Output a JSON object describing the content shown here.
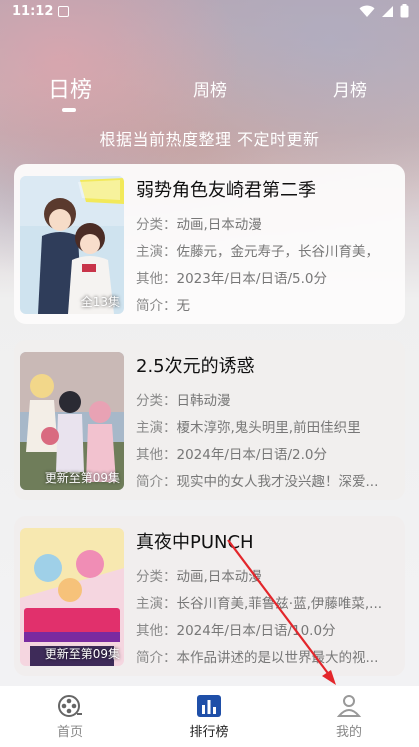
{
  "status_bar": {
    "time": "11:12"
  },
  "tabs": [
    {
      "label": "日榜",
      "active": true
    },
    {
      "label": "周榜",
      "active": false
    },
    {
      "label": "月榜",
      "active": false
    }
  ],
  "subtitle": "根据当前热度整理 不定时更新",
  "cards": [
    {
      "title": "弱势角色友崎君第二季",
      "episodes": "全13集",
      "category_key": "分类：",
      "category": "动画,日本动漫",
      "cast_key": "主演：",
      "cast": "佐藤元，金元寿子，长谷川育美，",
      "other_key": "其他：",
      "other": "2023年/日本/日语/5.0分",
      "intro_key": "简介：",
      "intro": "无"
    },
    {
      "title": "2.5次元的诱惑",
      "episodes": "更新至第09集",
      "category_key": "分类：",
      "category": "日韩动漫",
      "cast_key": "主演：",
      "cast": "榎木淳弥,鬼头明里,前田佳织里",
      "other_key": "其他：",
      "other": "2024年/日本/日语/2.0分",
      "intro_key": "简介：",
      "intro": "现实中的女人我才没兴趣！深爱..."
    },
    {
      "title": "真夜中PUNCH",
      "episodes": "更新至第09集",
      "category_key": "分类：",
      "category": "动画,日本动漫",
      "cast_key": "主演：",
      "cast": "长谷川育美,菲鲁兹·蓝,伊藤唯菜,...",
      "other_key": "其他：",
      "other": "2024年/日本/日语/10.0分",
      "intro_key": "简介：",
      "intro": "本作品讲述的是以世界最大的视..."
    }
  ],
  "nav": [
    {
      "label": "首页",
      "icon": "film-reel-icon",
      "active": false
    },
    {
      "label": "排行榜",
      "icon": "ranking-chart-icon",
      "active": true
    },
    {
      "label": "我的",
      "icon": "user-profile-icon",
      "active": false
    }
  ],
  "colors": {
    "accent": "#1f4fa8",
    "annotation": "#e3262b"
  }
}
